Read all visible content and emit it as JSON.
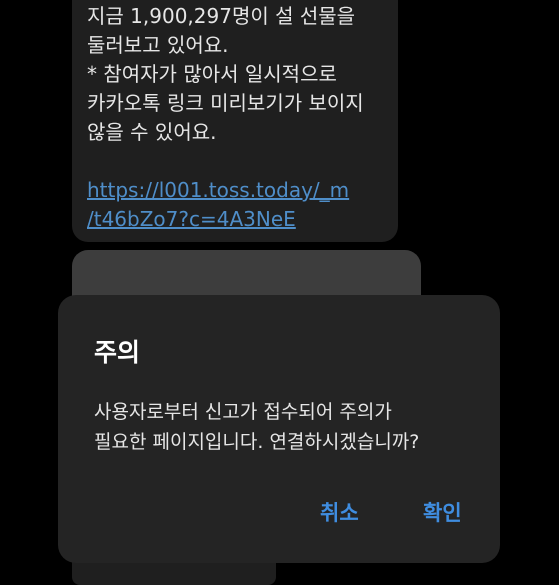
{
  "message": {
    "lines": [
      "지금 1,900,297명이 설 선물을",
      "둘러보고 있어요.",
      "* 참여자가 많아서 일시적으로",
      "카카오톡 링크 미리보기가 보이지",
      "않을 수 있어요."
    ],
    "link_lines": [
      "https://l001.toss.today/_m",
      "/t46bZo7?c=4A3NeE"
    ]
  },
  "dialog": {
    "title": "주의",
    "message_lines": [
      "사용자로부터 신고가 접수되어 주의가",
      "필요한 페이지입니다. 연결하시겠습니까?"
    ],
    "cancel_label": "취소",
    "confirm_label": "확인"
  },
  "colors": {
    "background": "#000000",
    "bubble": "#1f1f1f",
    "link": "#4f8ec9",
    "dialog": "#242424",
    "accent": "#3f8de0"
  }
}
